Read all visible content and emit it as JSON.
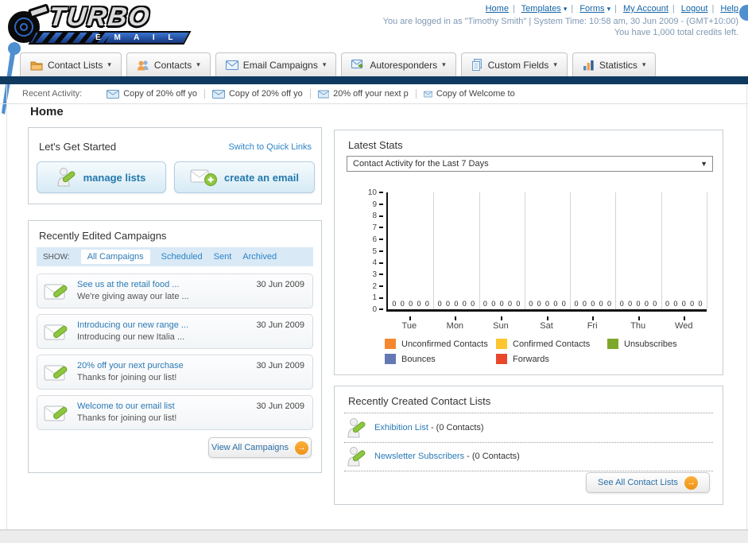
{
  "colors": {
    "navy_bar": "#10395F",
    "link_blue": "#1A6DA8",
    "orange_accent": "#F5A11C"
  },
  "icons": {
    "caret_down": "▾",
    "select_caret": "▼",
    "arrow_right": "→"
  },
  "header": {
    "logo_title": "TURBO",
    "logo_subtitle": "E M A I L",
    "nav_links": [
      {
        "label": "Home",
        "dropdown": false
      },
      {
        "label": "Templates",
        "dropdown": true
      },
      {
        "label": "Forms",
        "dropdown": true
      },
      {
        "label": "My Account",
        "dropdown": false
      },
      {
        "label": "Logout",
        "dropdown": false
      },
      {
        "label": "Help",
        "dropdown": false
      }
    ],
    "login_text": "You are logged in as \"Timothy Smith\" | System Time: 10:58 am, 30 Jun 2009 - (GMT+10:00)",
    "credits_text": "You have 1,000 total credits left."
  },
  "tabs": [
    {
      "label": "Contact Lists"
    },
    {
      "label": "Contacts"
    },
    {
      "label": "Email Campaigns"
    },
    {
      "label": "Autoresponders"
    },
    {
      "label": "Custom Fields"
    },
    {
      "label": "Statistics"
    }
  ],
  "recent_activity": {
    "label": "Recent Activity:",
    "items": [
      "Copy of 20% off yo",
      "Copy of 20% off yo",
      "20% off your next p",
      "Copy of Welcome to"
    ]
  },
  "page_title": "Home",
  "get_started": {
    "title": "Let's Get Started",
    "switch_link": "Switch to Quick Links",
    "buttons": [
      {
        "label": "manage lists"
      },
      {
        "label": "create an email"
      }
    ]
  },
  "campaigns": {
    "title": "Recently Edited Campaigns",
    "show_label": "SHOW:",
    "filters": [
      "All Campaigns",
      "Scheduled",
      "Sent",
      "Archived"
    ],
    "active_filter": "All Campaigns",
    "items": [
      {
        "title": "See us at the retail food ...",
        "subtitle": "We're giving away our late ...",
        "date": "30 Jun 2009"
      },
      {
        "title": "Introducing our new range ...",
        "subtitle": "Introducing our new Italia ...",
        "date": "30 Jun 2009"
      },
      {
        "title": "20% off your next purchase",
        "subtitle": "Thanks for joining our list!",
        "date": "30 Jun 2009"
      },
      {
        "title": "Welcome to our email list",
        "subtitle": "Thanks for joining our list!",
        "date": "30 Jun 2009"
      }
    ],
    "view_all_label": "View All Campaigns"
  },
  "stats": {
    "title": "Latest Stats",
    "dropdown_value": "Contact Activity for the Last 7 Days"
  },
  "chart_data": {
    "type": "bar",
    "title": "Contact Activity for the Last 7 Days",
    "categories": [
      "Tue",
      "Mon",
      "Sun",
      "Sat",
      "Fri",
      "Thu",
      "Wed"
    ],
    "series": [
      {
        "name": "Unconfirmed Contacts",
        "color": "#F5882F",
        "values": [
          0,
          0,
          0,
          0,
          0,
          0,
          0
        ]
      },
      {
        "name": "Confirmed Contacts",
        "color": "#FDC62F",
        "values": [
          0,
          0,
          0,
          0,
          0,
          0,
          0
        ]
      },
      {
        "name": "Unsubscribes",
        "color": "#7FA72B",
        "values": [
          0,
          0,
          0,
          0,
          0,
          0,
          0
        ]
      },
      {
        "name": "Bounces",
        "color": "#6478B4",
        "values": [
          0,
          0,
          0,
          0,
          0,
          0,
          0
        ]
      },
      {
        "name": "Forwards",
        "color": "#E9472C",
        "values": [
          0,
          0,
          0,
          0,
          0,
          0,
          0
        ]
      }
    ],
    "xlabel": "",
    "ylabel": "",
    "ylim": [
      0,
      10
    ],
    "ytick_step": 1,
    "grid": "vertical",
    "legend_position": "bottom",
    "data_labels": true
  },
  "contact_lists": {
    "title": "Recently Created Contact Lists",
    "items": [
      {
        "name": "Exhibition List",
        "count": "- (0 Contacts)"
      },
      {
        "name": "Newsletter Subscribers",
        "count": "- (0 Contacts)"
      }
    ],
    "see_all_label": "See All Contact Lists"
  }
}
